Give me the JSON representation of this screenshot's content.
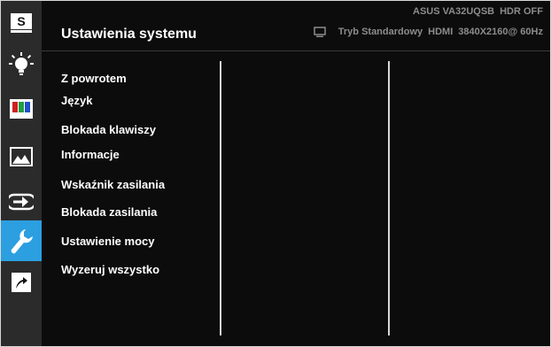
{
  "header": {
    "title": "Ustawienia systemu",
    "model": "ASUS  VA32UQSB",
    "hdr": "HDR OFF",
    "mode": "Tryb Standardowy",
    "input": "HDMI",
    "resolution": "3840X2160@ 60Hz"
  },
  "sidebar": {
    "items": [
      {
        "icon": "splendid-s-icon"
      },
      {
        "icon": "brightness-icon"
      },
      {
        "icon": "color-bars-icon"
      },
      {
        "icon": "image-icon"
      },
      {
        "icon": "input-select-icon"
      },
      {
        "icon": "wrench-icon",
        "active": true
      },
      {
        "icon": "shortcut-arrow-icon"
      }
    ]
  },
  "menu": {
    "items": [
      "Z powrotem",
      "Język",
      "Blokada klawiszy",
      "Informacje",
      "Wskaźnik zasilania",
      "Blokada zasilania",
      "Ustawienie mocy",
      "Wyzeruj wszystko"
    ]
  },
  "colors": {
    "accent": "#2c9fe0",
    "background": "#0c0c0c",
    "sidebar": "#2b2b2b",
    "status_text": "#8c8c8c"
  }
}
